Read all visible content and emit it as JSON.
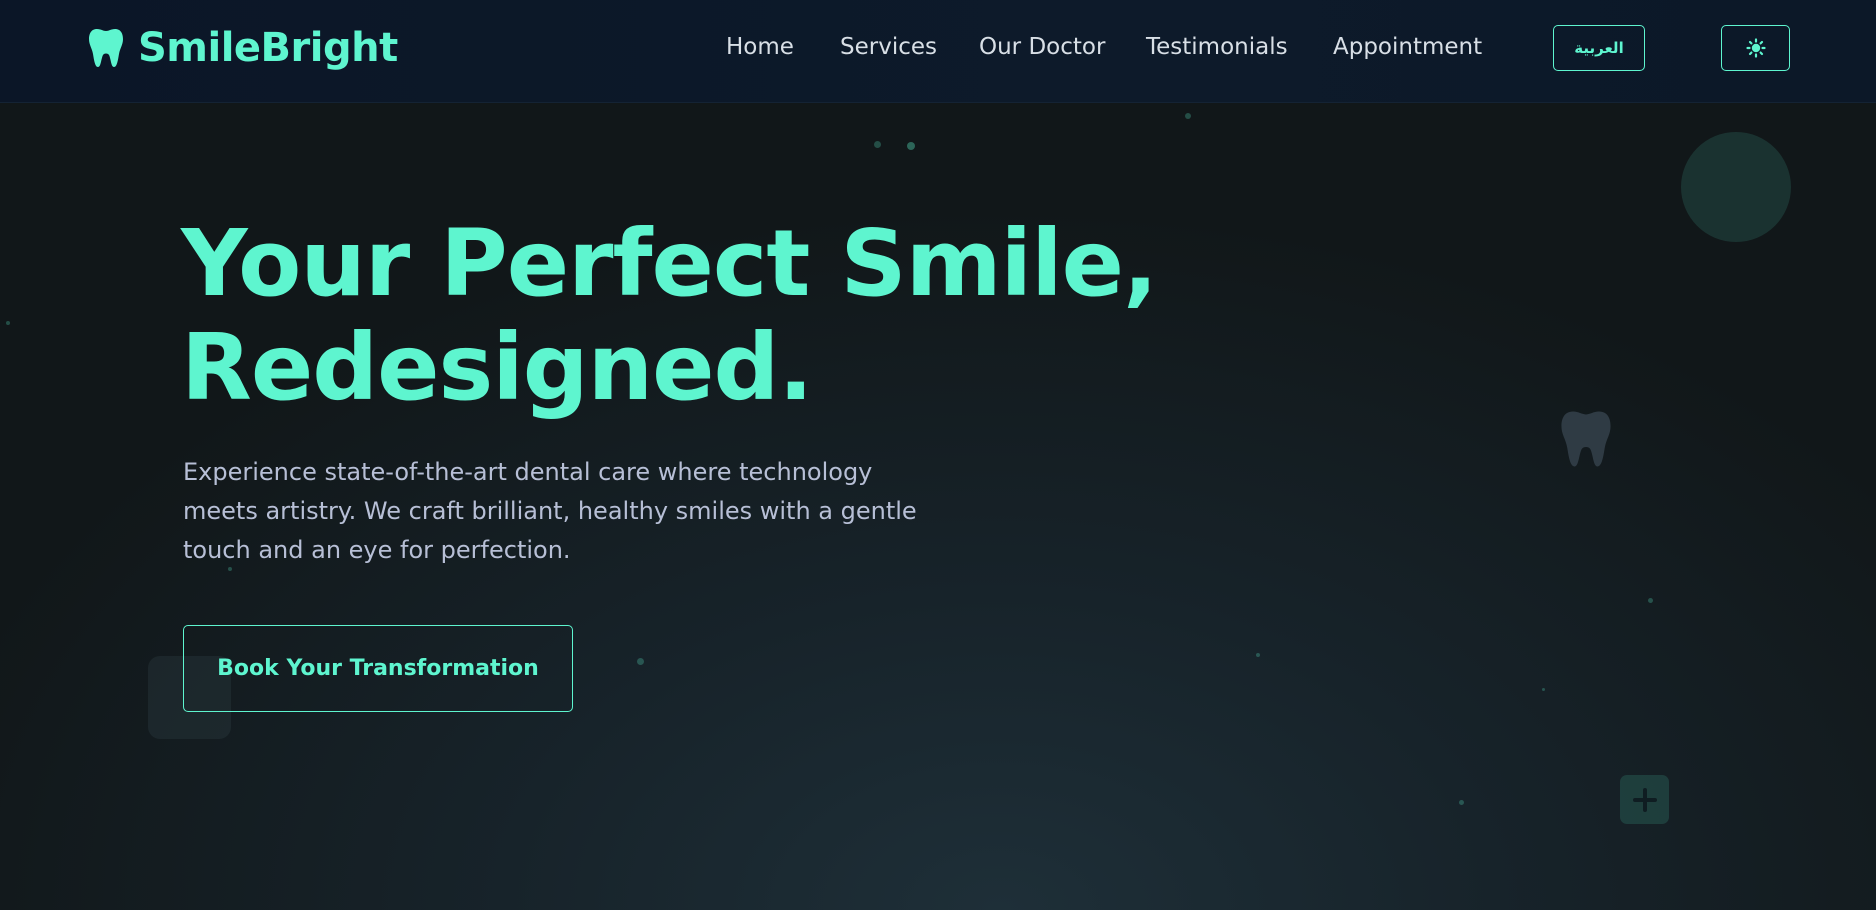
{
  "brand": {
    "name": "SmileBright",
    "logo_icon": "tooth-icon",
    "accent_color": "#5ef5cf"
  },
  "nav": {
    "items": [
      {
        "label": "Home"
      },
      {
        "label": "Services"
      },
      {
        "label": "Our Doctor"
      },
      {
        "label": "Testimonials"
      },
      {
        "label": "Appointment"
      }
    ],
    "language_button": "العربية",
    "theme_button_icon": "sun-icon"
  },
  "hero": {
    "title_line1": "Your Perfect Smile,",
    "title_line2": "Redesigned.",
    "subtitle": "Experience state-of-the-art dental care where technology meets artistry. We craft brilliant, healthy smiles with a gentle touch and an eye for perfection.",
    "cta_label": "Book Your Transformation"
  },
  "decorations": {
    "icons": [
      "tooth-icon",
      "plus-icon"
    ]
  }
}
